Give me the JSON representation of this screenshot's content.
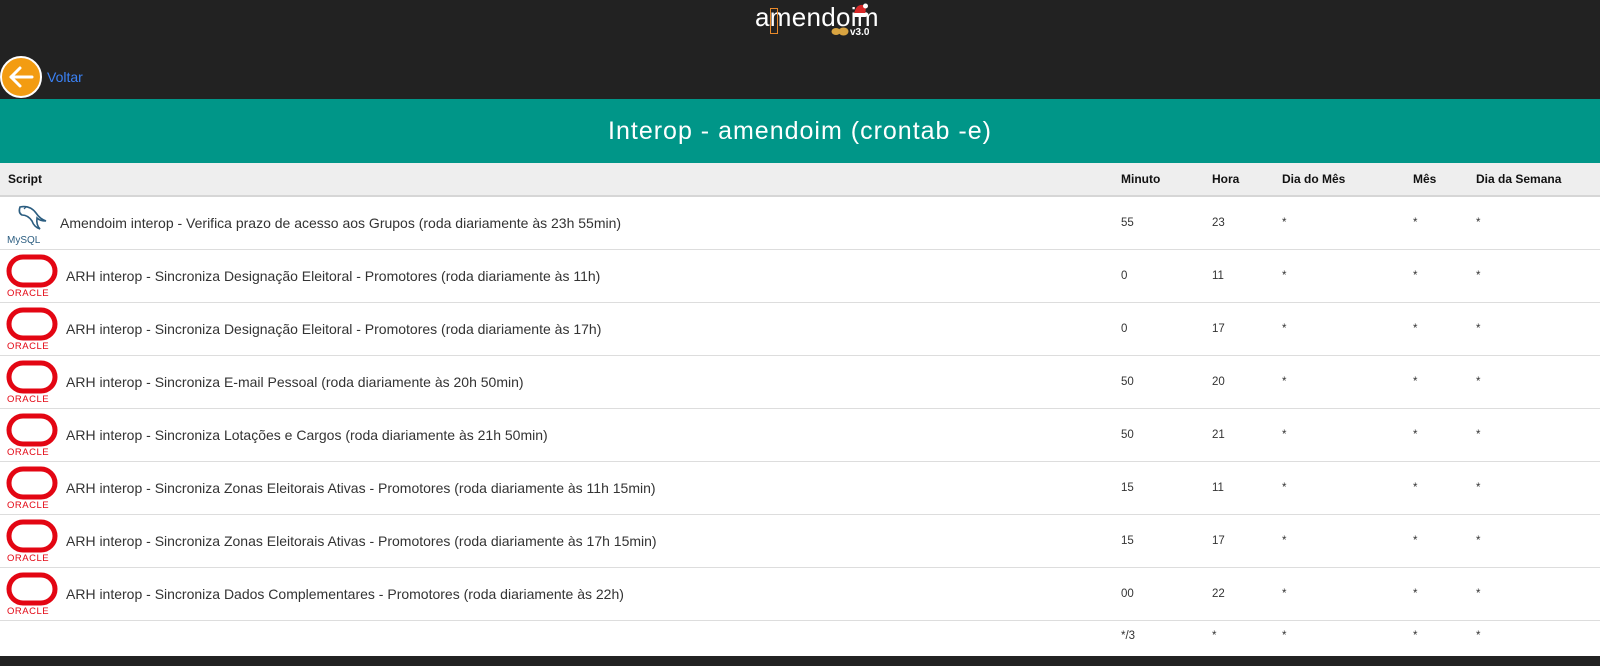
{
  "header": {
    "logo_text": "amendoim",
    "logo_version": "v3.0",
    "back_label": "Voltar"
  },
  "page_title": "Interop - amendoim (crontab -e)",
  "colors": {
    "background": "#222222",
    "title_bar": "#009688",
    "back_button": "#f39c12",
    "back_link": "#3b82f6",
    "oracle_red": "#e30613",
    "mysql_blue": "#2b5d80"
  },
  "table": {
    "columns": [
      "Script",
      "Minuto",
      "Hora",
      "Dia do Mês",
      "Mês",
      "Dia da Semana"
    ],
    "rows": [
      {
        "db": "mysql",
        "db_icon_label": "MySQL",
        "script": "Amendoim interop - Verifica prazo de acesso aos Grupos (roda diariamente às 23h 55min)",
        "minuto": "55",
        "hora": "23",
        "dia_mes": "*",
        "mes": "*",
        "dia_semana": "*"
      },
      {
        "db": "oracle",
        "db_icon_label": "ORACLE",
        "script": "ARH interop - Sincroniza Designação Eleitoral - Promotores (roda diariamente às 11h)",
        "minuto": "0",
        "hora": "11",
        "dia_mes": "*",
        "mes": "*",
        "dia_semana": "*"
      },
      {
        "db": "oracle",
        "db_icon_label": "ORACLE",
        "script": "ARH interop - Sincroniza Designação Eleitoral - Promotores (roda diariamente às 17h)",
        "minuto": "0",
        "hora": "17",
        "dia_mes": "*",
        "mes": "*",
        "dia_semana": "*"
      },
      {
        "db": "oracle",
        "db_icon_label": "ORACLE",
        "script": "ARH interop - Sincroniza E-mail Pessoal (roda diariamente às 20h 50min)",
        "minuto": "50",
        "hora": "20",
        "dia_mes": "*",
        "mes": "*",
        "dia_semana": "*"
      },
      {
        "db": "oracle",
        "db_icon_label": "ORACLE",
        "script": "ARH interop - Sincroniza Lotações e Cargos (roda diariamente às 21h 50min)",
        "minuto": "50",
        "hora": "21",
        "dia_mes": "*",
        "mes": "*",
        "dia_semana": "*"
      },
      {
        "db": "oracle",
        "db_icon_label": "ORACLE",
        "script": "ARH interop - Sincroniza Zonas Eleitorais Ativas - Promotores (roda diariamente às 11h 15min)",
        "minuto": "15",
        "hora": "11",
        "dia_mes": "*",
        "mes": "*",
        "dia_semana": "*"
      },
      {
        "db": "oracle",
        "db_icon_label": "ORACLE",
        "script": "ARH interop - Sincroniza Zonas Eleitorais Ativas - Promotores (roda diariamente às 17h 15min)",
        "minuto": "15",
        "hora": "17",
        "dia_mes": "*",
        "mes": "*",
        "dia_semana": "*"
      },
      {
        "db": "oracle",
        "db_icon_label": "ORACLE",
        "script": "ARH interop - Sincroniza Dados Complementares - Promotores (roda diariamente às 22h)",
        "minuto": "00",
        "hora": "22",
        "dia_mes": "*",
        "mes": "*",
        "dia_semana": "*"
      },
      {
        "db": "",
        "db_icon_label": "",
        "script": "",
        "minuto": "*/3",
        "hora": "*",
        "dia_mes": "*",
        "mes": "*",
        "dia_semana": "*"
      }
    ]
  }
}
